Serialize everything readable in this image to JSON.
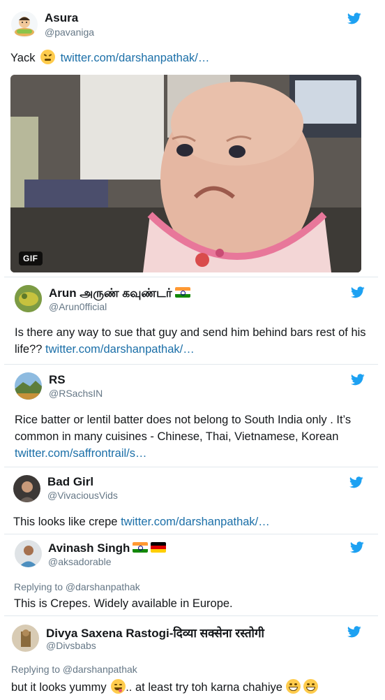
{
  "tweets": [
    {
      "name": "Asura",
      "handle": "@pavaniga",
      "text": "Yack",
      "link": "twitter.com/darshanpathak/…",
      "media_badge": "GIF"
    },
    {
      "name": "Arun அருண் கவுண்டர்",
      "handle": "@Arun0fficial",
      "text": "Is there any way to sue that guy and send him behind bars rest of his life??",
      "link": "twitter.com/darshanpathak/…"
    },
    {
      "name": "RS",
      "handle": "@RSachsIN",
      "text": "Rice batter or lentil batter does not belong to South India only . It’s common in many cuisines - Chinese, Thai, Vietnamese, Korean",
      "link": "twitter.com/saffrontrail/s…"
    },
    {
      "name": "Bad Girl",
      "handle": "@VivaciousVids",
      "text": "This looks like crepe",
      "link": "twitter.com/darshanpathak/…"
    },
    {
      "name": "Avinash Singh",
      "handle": "@aksadorable",
      "reply_to": "Replying to @darshanpathak",
      "text": "This is Crepes. Widely available in Europe."
    },
    {
      "name": "Divya Saxena Rastogi-दिव्या सक्सेना रस्तोगी",
      "handle": "@Divsbabs",
      "reply_to": "Replying to @darshanpathak",
      "text_a": "but it looks yummy",
      "text_b": ".. at least try toh karna chahiye"
    }
  ],
  "colors": {
    "twitter_blue": "#1da1f2",
    "link": "#1b6fa8",
    "muted": "#657786",
    "divider": "#e1e8ed"
  },
  "icons": {
    "bird": "twitter-bird-icon",
    "flag_india": "india-flag-icon",
    "flag_germany": "germany-flag-icon"
  }
}
